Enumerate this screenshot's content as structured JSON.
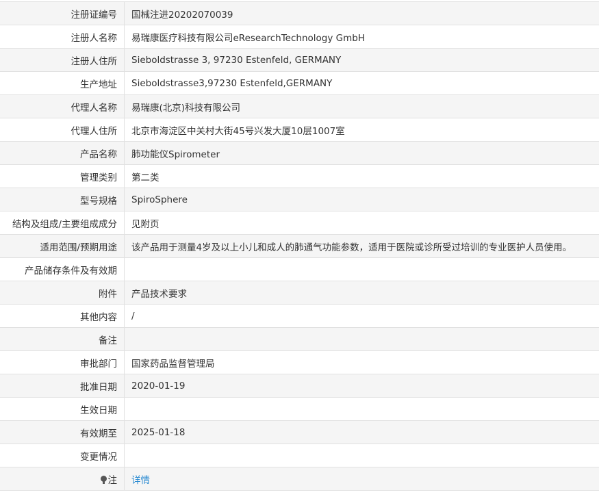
{
  "rows": [
    {
      "label": "注册证编号",
      "value": "国械注进20202070039"
    },
    {
      "label": "注册人名称",
      "value": "易瑞康医疗科技有限公司eResearchTechnology GmbH"
    },
    {
      "label": "注册人住所",
      "value": "Sieboldstrasse 3, 97230 Estenfeld, GERMANY"
    },
    {
      "label": "生产地址",
      "value": "Sieboldstrasse3,97230 Estenfeld,GERMANY"
    },
    {
      "label": "代理人名称",
      "value": "易瑞康(北京)科技有限公司"
    },
    {
      "label": "代理人住所",
      "value": "北京市海淀区中关村大街45号兴发大厦10层1007室"
    },
    {
      "label": "产品名称",
      "value": "肺功能仪Spirometer"
    },
    {
      "label": "管理类别",
      "value": "第二类"
    },
    {
      "label": "型号规格",
      "value": "SpiroSphere"
    },
    {
      "label": "结构及组成/主要组成成分",
      "value": "见附页"
    },
    {
      "label": "适用范围/预期用途",
      "value": "该产品用于测量4岁及以上小儿和成人的肺通气功能参数，适用于医院或诊所受过培训的专业医护人员使用。"
    },
    {
      "label": "产品储存条件及有效期",
      "value": ""
    },
    {
      "label": "附件",
      "value": "产品技术要求"
    },
    {
      "label": "其他内容",
      "value": "/"
    },
    {
      "label": "备注",
      "value": ""
    },
    {
      "label": "审批部门",
      "value": "国家药品监督管理局"
    },
    {
      "label": "批准日期",
      "value": "2020-01-19"
    },
    {
      "label": "生效日期",
      "value": ""
    },
    {
      "label": "有效期至",
      "value": "2025-01-18"
    },
    {
      "label": "变更情况",
      "value": ""
    }
  ],
  "note_row": {
    "icon": "lightbulb-icon",
    "label": "注",
    "link_text": "详情"
  },
  "colors": {
    "link": "#2a8bd2",
    "alt_row_bg": "#f5f5f5",
    "border": "#e1e1e1"
  }
}
